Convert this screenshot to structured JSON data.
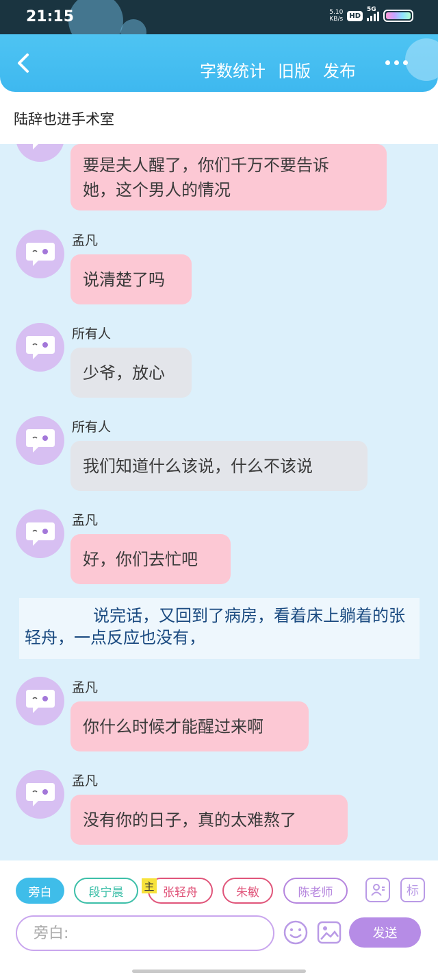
{
  "status_bar": {
    "time": "21:15",
    "net_speed_value": "5.10",
    "net_speed_unit": "KB/s",
    "hd": "HD",
    "network": "5G"
  },
  "header": {
    "actions": [
      "字数统计",
      "旧版",
      "发布"
    ]
  },
  "document_title": "陆辞也进手术室",
  "messages": [
    {
      "speaker": "",
      "text_lines": [
        "要是夫人醒了，你们千万不要告诉",
        "她，这个男人的情况"
      ],
      "style": "pink"
    },
    {
      "speaker": "孟凡",
      "text_lines": [
        "说清楚了吗"
      ],
      "style": "pink"
    },
    {
      "speaker": "所有人",
      "text_lines": [
        "少爷，放心"
      ],
      "style": "gray"
    },
    {
      "speaker": "所有人",
      "text_lines": [
        "我们知道什么该说，什么不该说"
      ],
      "style": "gray"
    },
    {
      "speaker": "孟凡",
      "text_lines": [
        "好，你们去忙吧"
      ],
      "style": "pink"
    },
    {
      "speaker": "孟凡",
      "text_lines": [
        "你什么时候才能醒过来啊"
      ],
      "style": "pink"
    },
    {
      "speaker": "孟凡",
      "text_lines": [
        "没有你的日子，真的太难熬了"
      ],
      "style": "pink"
    }
  ],
  "narration": "说完话，又回到了病房，看着床上躺着的张轻舟，一点反应也没有，",
  "composer": {
    "roles": [
      {
        "label": "旁白",
        "color": "#3fbde9",
        "active": true
      },
      {
        "label": "段宁晨",
        "color": "#3cbfa8",
        "active": false
      },
      {
        "label": "张轻舟",
        "color": "#e0557a",
        "active": false,
        "badge": "主"
      },
      {
        "label": "朱敏",
        "color": "#e0557a",
        "active": false
      },
      {
        "label": "陈老师",
        "color": "#b585de",
        "active": false
      }
    ],
    "mark_label": "标",
    "input_placeholder": "旁白:",
    "send_label": "发送"
  }
}
